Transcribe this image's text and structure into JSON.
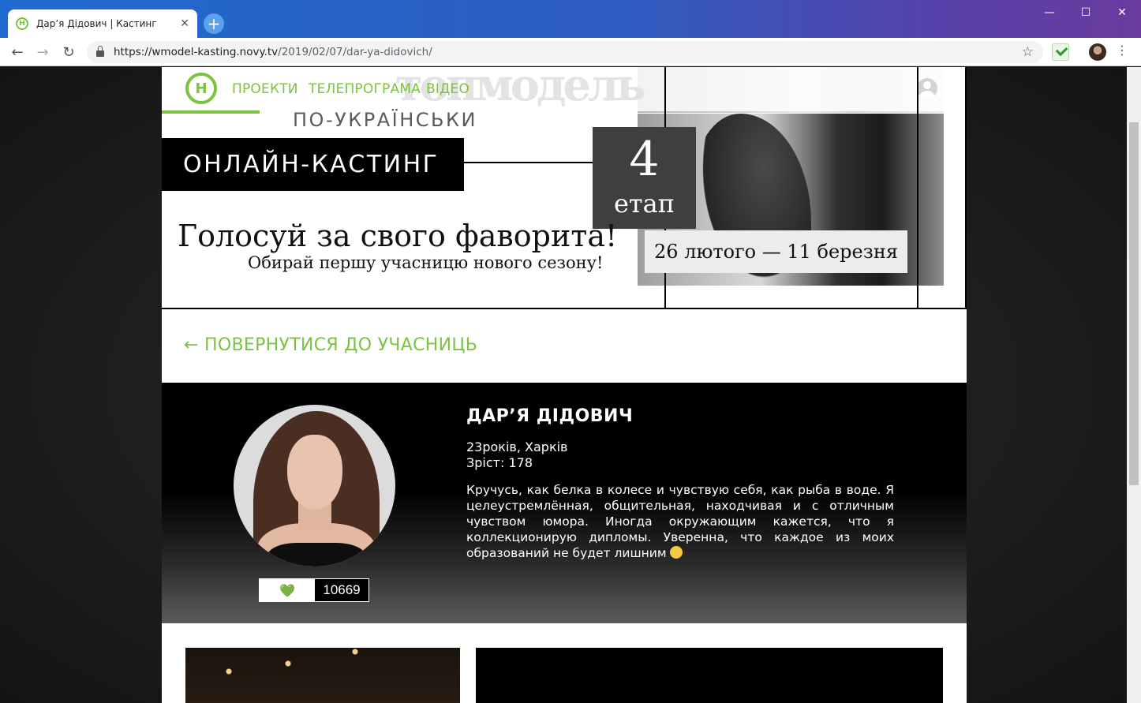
{
  "browser": {
    "tab_title": "Дар’я Дідович | Кастинг",
    "url_host": "https://wmodel-kasting.novy.tv",
    "url_path": "/2019/02/07/dar-ya-didovich/"
  },
  "site": {
    "nav": [
      "ПРОЕКТИ",
      "ТЕЛЕПРОГРАМА",
      "ВІДЕО"
    ],
    "logo_letter": "Н",
    "brand_bg": "топмодель",
    "subbrand": "ПО-УКРАЇНСЬКИ"
  },
  "banner": {
    "casting_label": "ОНЛАЙН-КАСТИНГ",
    "headline": "Голосуй за свого фаворита!",
    "subline": "Обирай першу учасницю нового сезону!",
    "stage_number": "4",
    "stage_word": "етап",
    "dates": "26 лютого — 11 березня"
  },
  "back_link": "← ПОВЕРНУТИСЯ ДО УЧАСНИЦЬ",
  "profile": {
    "name": "ДАР’Я ДІДОВИЧ",
    "age_city": "23років, Харків",
    "height": "Зріст: 178",
    "bio": "Кручусь, как белка в колесе и чувствую себя, как рыба в воде. Я целеустремлённая, общительная, находчивая и с отличным чувством юмора. Иногда окружающим кажется, что я коллекционирую дипломы. Уверенна, что каждое из моих образований не будет лишним",
    "votes": "10669",
    "heart": "💚"
  },
  "colors": {
    "accent": "#7cc242"
  }
}
